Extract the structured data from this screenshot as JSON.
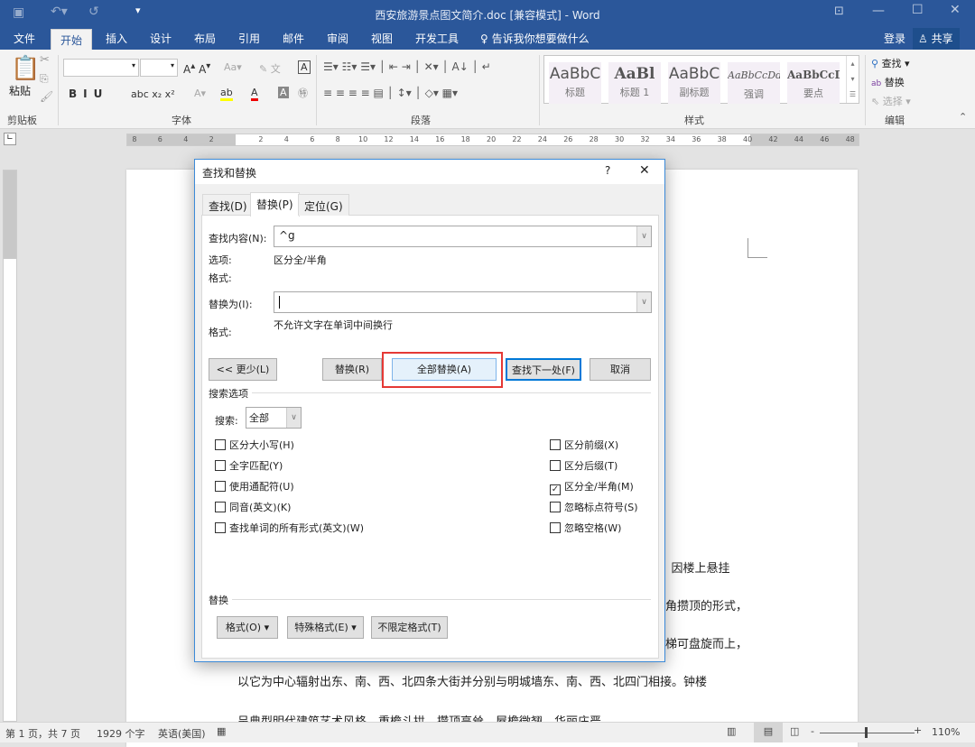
{
  "window": {
    "title": "西安旅游景点图文简介.doc [兼容模式] - Word",
    "login": "登录",
    "share": "共享"
  },
  "ribbon_tabs": [
    "文件",
    "开始",
    "插入",
    "设计",
    "布局",
    "引用",
    "邮件",
    "审阅",
    "视图",
    "开发工具"
  ],
  "tell_me": "告诉我你想要做什么",
  "ribbon": {
    "paste": "粘贴",
    "groups": {
      "clipboard": "剪贴板",
      "font": "字体",
      "paragraph": "段落",
      "styles": "样式",
      "editing": "编辑"
    },
    "styles": [
      {
        "sample": "AaBbC",
        "name": "标题"
      },
      {
        "sample": "AaBl",
        "name": "标题 1"
      },
      {
        "sample": "AaBbC",
        "name": "副标题"
      },
      {
        "sample": "AaBbCcDd",
        "name": "强调"
      },
      {
        "sample": "AaBbCcD",
        "name": "要点"
      }
    ],
    "find": "查找",
    "replace": "替换",
    "select": "选择"
  },
  "ruler": {
    "left": [
      "8",
      "6",
      "4",
      "2"
    ],
    "right": [
      "2",
      "4",
      "6",
      "8",
      "10",
      "12",
      "14",
      "16",
      "18",
      "20",
      "22",
      "24",
      "26",
      "28",
      "30",
      "32",
      "34",
      "36",
      "38",
      "40",
      "42",
      "44",
      "46",
      "48"
    ]
  },
  "document": {
    "lines": [
      "），因楼上悬挂",
      "角攒顶的形式，",
      "梯可盘旋而上，",
      "以它为中心辐射出东、南、西、北四条大街并分别与明城墙东、南、西、北四门相接。钟楼",
      "呈典型明代建筑艺术风格，重檐斗拱，攒顶高耸，屋檐微翘，华丽庄严。"
    ]
  },
  "dialog": {
    "title": "查找和替换",
    "help": "?",
    "close": "✕",
    "tabs": [
      "查找(D)",
      "替换(P)",
      "定位(G)"
    ],
    "active_tab": 1,
    "find_label": "查找内容(N):",
    "find_value": "^g",
    "options_label": "选项:",
    "options_value": "区分全/半角",
    "format_label": "格式:",
    "replace_label": "替换为(I):",
    "replace_value": "",
    "replace_format_label": "格式:",
    "replace_format_value": "不允许文字在单词中间换行",
    "buttons": {
      "less": "<< 更少(L)",
      "replace": "替换(R)",
      "replace_all": "全部替换(A)",
      "find_next": "查找下一处(F)",
      "cancel": "取消"
    },
    "search_options": "搜索选项",
    "search_label": "搜索:",
    "search_value": "全部",
    "checks_left": [
      {
        "label": "区分大小写(H)",
        "checked": false
      },
      {
        "label": "全字匹配(Y)",
        "checked": false
      },
      {
        "label": "使用通配符(U)",
        "checked": false
      },
      {
        "label": "同音(英文)(K)",
        "checked": false
      },
      {
        "label": "查找单词的所有形式(英文)(W)",
        "checked": false
      }
    ],
    "checks_right": [
      {
        "label": "区分前缀(X)",
        "checked": false
      },
      {
        "label": "区分后缀(T)",
        "checked": false
      },
      {
        "label": "区分全/半角(M)",
        "checked": true
      },
      {
        "label": "忽略标点符号(S)",
        "checked": false
      },
      {
        "label": "忽略空格(W)",
        "checked": false
      }
    ],
    "replace_section": "替换",
    "format_btn": "格式(O)",
    "special_btn": "特殊格式(E)",
    "no_format_btn": "不限定格式(T)",
    "highlight_color": "#e53935"
  },
  "status": {
    "page": "第 1 页，共 7 页",
    "words": "1929 个字",
    "language": "英语(美国)",
    "zoom": "110%",
    "zoom_level_percent": 110
  },
  "colors": {
    "brand": "#2b579a"
  }
}
